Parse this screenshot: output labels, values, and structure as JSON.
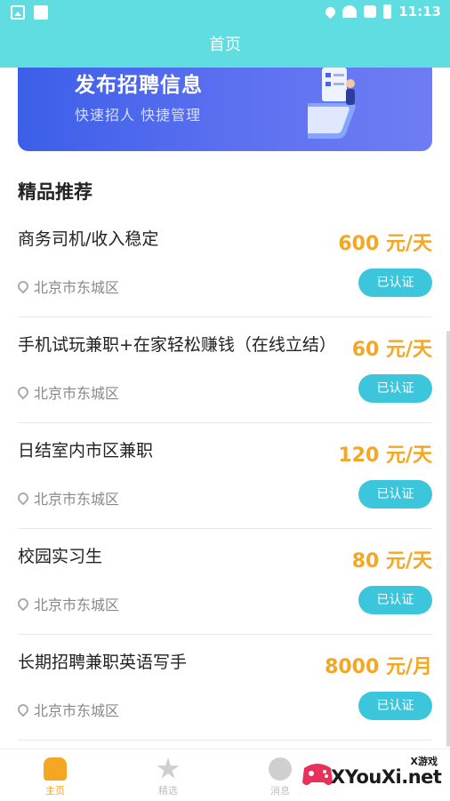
{
  "status_bar": {
    "time": "11:13"
  },
  "header": {
    "title": "首页"
  },
  "banner": {
    "title": "发布招聘信息",
    "subtitle": "快速招人  快捷管理"
  },
  "section": {
    "title": "精品推荐"
  },
  "jobs": [
    {
      "title": "商务司机/收入稳定",
      "pay": "600 元/天",
      "location": "北京市东城区",
      "badge": "已认证"
    },
    {
      "title": "手机试玩兼职+在家轻松赚钱（在线立结）",
      "pay": "60 元/天",
      "location": "北京市东城区",
      "badge": "已认证"
    },
    {
      "title": "日结室内市区兼职",
      "pay": "120 元/天",
      "location": "北京市东城区",
      "badge": "已认证"
    },
    {
      "title": "校园实习生",
      "pay": "80 元/天",
      "location": "北京市东城区",
      "badge": "已认证"
    },
    {
      "title": "长期招聘兼职英语写手",
      "pay": "8000 元/月",
      "location": "北京市东城区",
      "badge": "已认证"
    }
  ],
  "tabs": [
    {
      "label": "主页",
      "icon": "home-icon",
      "active": true
    },
    {
      "label": "精选",
      "icon": "star-icon",
      "active": false
    },
    {
      "label": "消息",
      "icon": "message-icon",
      "active": false
    }
  ],
  "watermark": {
    "text": "XYouXi.net",
    "tag": "X游戏"
  },
  "colors": {
    "primary": "#5fdde0",
    "accent": "#f5a623",
    "badge": "#3cc6dc",
    "banner": "#4a63ec"
  }
}
